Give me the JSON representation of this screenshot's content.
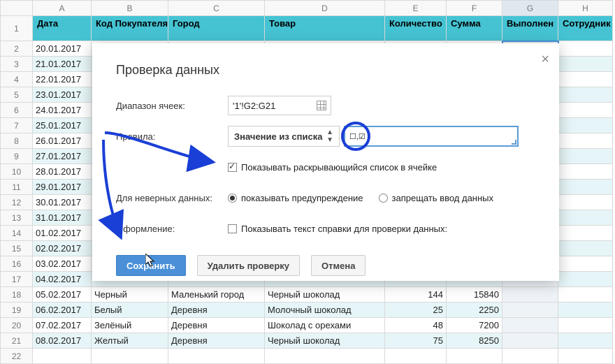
{
  "columns": [
    "A",
    "B",
    "C",
    "D",
    "E",
    "F",
    "G",
    "H"
  ],
  "headers": {
    "A": "Дата",
    "B": "Код Покупателя",
    "C": "Город",
    "D": "Товар",
    "E": "Количество",
    "F": "Сумма",
    "G": "Выполнен",
    "H": "Сотрудник"
  },
  "rows": [
    {
      "n": 2,
      "date": "20.01.2017"
    },
    {
      "n": 3,
      "date": "21.01.2017"
    },
    {
      "n": 4,
      "date": "22.01.2017"
    },
    {
      "n": 5,
      "date": "23.01.2017"
    },
    {
      "n": 6,
      "date": "24.01.2017"
    },
    {
      "n": 7,
      "date": "25.01.2017"
    },
    {
      "n": 8,
      "date": "26.01.2017"
    },
    {
      "n": 9,
      "date": "27.01.2017"
    },
    {
      "n": 10,
      "date": "28.01.2017"
    },
    {
      "n": 11,
      "date": "29.01.2017"
    },
    {
      "n": 12,
      "date": "30.01.2017"
    },
    {
      "n": 13,
      "date": "31.01.2017"
    },
    {
      "n": 14,
      "date": "01.02.2017"
    },
    {
      "n": 15,
      "date": "02.02.2017"
    },
    {
      "n": 16,
      "date": "03.02.2017"
    },
    {
      "n": 17,
      "date": "04.02.2017"
    },
    {
      "n": 18,
      "date": "05.02.2017",
      "buyer": "Черный",
      "city": "Маленький город",
      "prod": "Черный шоколад",
      "qty": 144,
      "sum": 15840
    },
    {
      "n": 19,
      "date": "06.02.2017",
      "buyer": "Белый",
      "city": "Деревня",
      "prod": "Молочный шоколад",
      "qty": 25,
      "sum": 2250
    },
    {
      "n": 20,
      "date": "07.02.2017",
      "buyer": "Зелёный",
      "city": "Деревня",
      "prod": "Шоколад с орехами",
      "qty": 48,
      "sum": 7200
    },
    {
      "n": 21,
      "date": "08.02.2017",
      "buyer": "Желтый",
      "city": "Деревня",
      "prod": "Черный шоколад",
      "qty": 75,
      "sum": 8250
    },
    {
      "n": 22,
      "date": ""
    }
  ],
  "dialog": {
    "title": "Проверка данных",
    "range_label": "Диапазон ячеек:",
    "range_value": "'1'!G2:G21",
    "rules_label": "Правила:",
    "rule_select": "Значение из списка",
    "rule_value_icons": "☐,☑",
    "show_dropdown": "Показывать раскрывающийся список в ячейке",
    "invalid_label": "Для неверных данных:",
    "invalid_opt1": "показывать предупреждение",
    "invalid_opt2": "запрещать ввод данных",
    "appearance_label": "Оформление:",
    "appearance_text": "Показывать текст справки для проверки данных:",
    "btn_save": "Сохранить",
    "btn_delete": "Удалить проверку",
    "btn_cancel": "Отмена"
  }
}
